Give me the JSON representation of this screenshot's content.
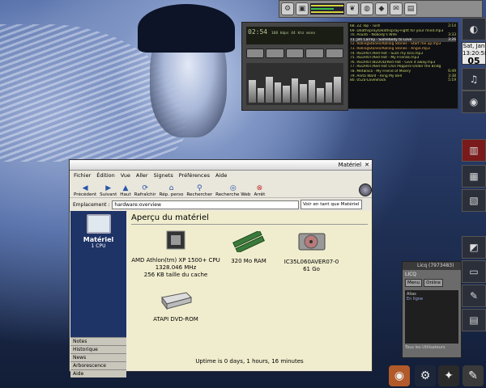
{
  "top_panel": {
    "icons": [
      "gear-icon",
      "monitor-icon",
      "leaf-icon",
      "globe-icon",
      "fish-icon",
      "mail-icon",
      "terminal-icon"
    ]
  },
  "clock": {
    "day": "Sat, Jan",
    "time": "13:20:58",
    "date": "05"
  },
  "xmms": {
    "lcd_time": "02:54",
    "lcd_info": "160 kbps 44 khz mono",
    "playlist": [
      {
        "title": "68. ZZ Top - Tush",
        "time": "2:14"
      },
      {
        "title": "69. Deathspray/Deathspray-Fight for your mind.mp3",
        "time": ""
      },
      {
        "title": "70. Asunti - Nobody's Wife",
        "time": "3:33"
      },
      {
        "title": "71. Jim Carrey - Somebody to Love",
        "time": "3:26"
      },
      {
        "title": "72. RollingStones/Rolling Stones - Start me up.mp3",
        "time": ""
      },
      {
        "title": "73. RollingStones/Rolling Stones - Angie.mp3",
        "time": ""
      },
      {
        "title": "74. REDHOT/Red Hot - Suck my kiss.mp3",
        "time": ""
      },
      {
        "title": "75. REDHOT/Red Hot - My Friends.mp3",
        "time": ""
      },
      {
        "title": "76. REDHOT/BLOOD/Red Hot - Give it away.mp3",
        "time": ""
      },
      {
        "title": "77. REDHOT/Red Hot Chili Peppers-Under the Bridg",
        "time": ""
      },
      {
        "title": "78. Metallica - My Friend of Misery",
        "time": "6:49"
      },
      {
        "title": "79. Anita Ward - Ring My Bell",
        "time": "3:38"
      },
      {
        "title": "80. 052a-LoveShack",
        "time": "5:19"
      }
    ]
  },
  "window": {
    "title": "Matériel",
    "menu": [
      "Fichier",
      "Édition",
      "Vue",
      "Aller",
      "Signets",
      "Préférences",
      "Aide"
    ],
    "toolbar": [
      {
        "label": "Précédent",
        "icon": "back-arrow-icon"
      },
      {
        "label": "Suivant",
        "icon": "forward-arrow-icon"
      },
      {
        "label": "Haut",
        "icon": "up-arrow-icon"
      },
      {
        "label": "Rafraîchir",
        "icon": "refresh-icon"
      },
      {
        "label": "Rép. perso",
        "icon": "home-icon"
      },
      {
        "label": "Rechercher",
        "icon": "search-icon"
      },
      {
        "label": "Recherche Web",
        "icon": "web-search-icon"
      },
      {
        "label": "Arrêt",
        "icon": "stop-icon"
      }
    ],
    "location_label": "Emplacement :",
    "location_value": "hardware:overview",
    "view_as": "Voir en tant que Matériel",
    "sidebar": {
      "title": "Matériel",
      "subtitle": "1 CPU",
      "tabs": [
        "Notes",
        "Historique",
        "News",
        "Arborescence",
        "Aide"
      ]
    },
    "heading": "Aperçu du matériel",
    "devices": {
      "cpu": [
        "AMD Athlon(tm) XP 1500+ CPU",
        "1328.046 MHz",
        "256 KB taille du cache"
      ],
      "ram": [
        "320 Mo RAM"
      ],
      "disk": [
        "IC35L060AVER07-0",
        "61 Go"
      ],
      "dvd": [
        "ATAPI DVD-ROM"
      ]
    },
    "uptime": "Uptime is 0 days, 1 hours, 16 minutes"
  },
  "licq": {
    "title": "Licq (7973483)",
    "label": "LICQ",
    "menu_button": "Menu",
    "status_button": "Online",
    "column": "Alias",
    "group": "En ligne",
    "footer": "Tous les Utilisateurs"
  }
}
